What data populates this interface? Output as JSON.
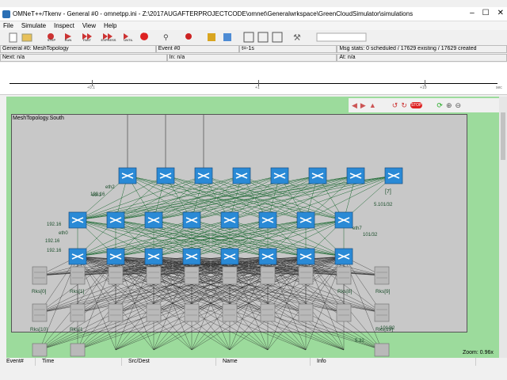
{
  "window": {
    "title": "OMNeT++/Tkenv - General #0 - omnetpp.ini - Z:\\2017AUGAFTERPROJECTCODE\\omnet\\Generalwrkspace\\GreenCloudSimulator\\simulations",
    "controls": [
      "–",
      "☐",
      "✕"
    ]
  },
  "menu": [
    "File",
    "Simulate",
    "Inspect",
    "View",
    "Help"
  ],
  "toolbar": {
    "step": "STEP",
    "run": "RUN",
    "fast": "FAST",
    "express": "EXPRESS",
    "until": "UNTIL",
    "stop": "STOP"
  },
  "info1": {
    "network": "General #0: MeshTopology",
    "event": "Event #0",
    "time": "t=-1s",
    "msgstats": "Msg stats: 0 scheduled / 17629 existing / 17629 created"
  },
  "info2": {
    "next": "Next: n/a",
    "in": "In: n/a",
    "at": "At: n/a"
  },
  "timeline": {
    "ticks": [
      "+0.1",
      "+1",
      "+10"
    ],
    "unit": "sec"
  },
  "canvas": {
    "module_title": "MeshTopology.South",
    "zoom": "Zoom: 0.96x"
  },
  "nodes": {
    "core_label": "[7]",
    "eth_labels": [
      "eth2",
      "eth1",
      "eth0",
      "eth7"
    ],
    "ip_labels": [
      "192.16",
      "192.16",
      "192.16",
      "192.16",
      "5.101/32",
      "101/32",
      "101/32",
      "5.32"
    ],
    "rack_labels": [
      "Rks[0]",
      "Rks[1]",
      "Rks[8]",
      "Rks[9]",
      "Rks[10]",
      "Rks[1",
      "Rks[19]",
      "Rks[19]"
    ]
  },
  "colors": {
    "canvas_bg": "#9cdb9c",
    "module_bg": "#c8c8c8",
    "link": "#1f6b35",
    "switch": "#2a8ad6"
  },
  "statusbar": [
    "Event#",
    "Time",
    "Src/Dest",
    "Name",
    "Info"
  ]
}
